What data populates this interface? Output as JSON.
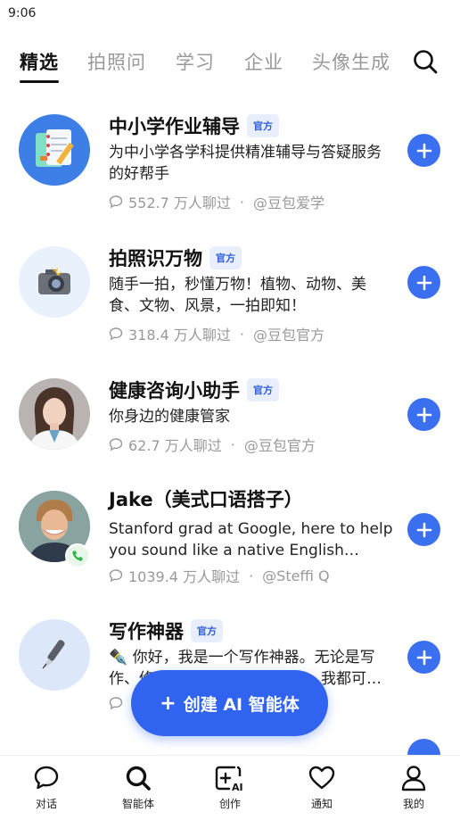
{
  "status_bar": {
    "time": "9:06"
  },
  "tabs": [
    {
      "label": "精选",
      "active": true
    },
    {
      "label": "拍照问",
      "active": false
    },
    {
      "label": "学习",
      "active": false
    },
    {
      "label": "企业",
      "active": false
    },
    {
      "label": "头像生成",
      "active": false
    }
  ],
  "items": [
    {
      "name": "中小学作业辅导",
      "badge": "官方",
      "desc": "为中小学各学科提供精准辅导与答疑服务的好帮手",
      "chats": "552.7 万人聊过",
      "author": "@豆包爱学"
    },
    {
      "name": "拍照识万物",
      "badge": "官方",
      "desc": "随手一拍，秒懂万物！植物、动物、美食、文物、风景，一拍即知！",
      "chats": "318.4 万人聊过",
      "author": "@豆包官方"
    },
    {
      "name": "健康咨询小助手",
      "badge": "官方",
      "desc": "你身边的健康管家",
      "chats": "62.7 万人聊过",
      "author": "@豆包官方"
    },
    {
      "name": "Jake（美式口语搭子）",
      "badge": "",
      "desc": "Stanford grad at Google, here to help you sound like a native English speaker.",
      "chats": "1039.4 万人聊过",
      "author": "@Steffi Q"
    },
    {
      "name": "写作神器",
      "badge": "官方",
      "desc": "✒️ 你好，我是一个写作神器。无论是写作、修改还是润色文章、创作，我都可以帮你。",
      "chats": "",
      "author": ""
    }
  ],
  "create_button": {
    "label": "创建 AI 智能体",
    "plus": "+"
  },
  "bottom_nav": [
    {
      "label": "对话",
      "icon": "chat-bubble-icon"
    },
    {
      "label": "智能体",
      "icon": "search-icon"
    },
    {
      "label": "创作",
      "icon": "create-ai-icon"
    },
    {
      "label": "通知",
      "icon": "heart-icon"
    },
    {
      "label": "我的",
      "icon": "person-icon"
    }
  ],
  "colors": {
    "accent": "#3a6ff0",
    "badge_bg": "#e8eefc",
    "badge_text": "#2f5fd8"
  }
}
